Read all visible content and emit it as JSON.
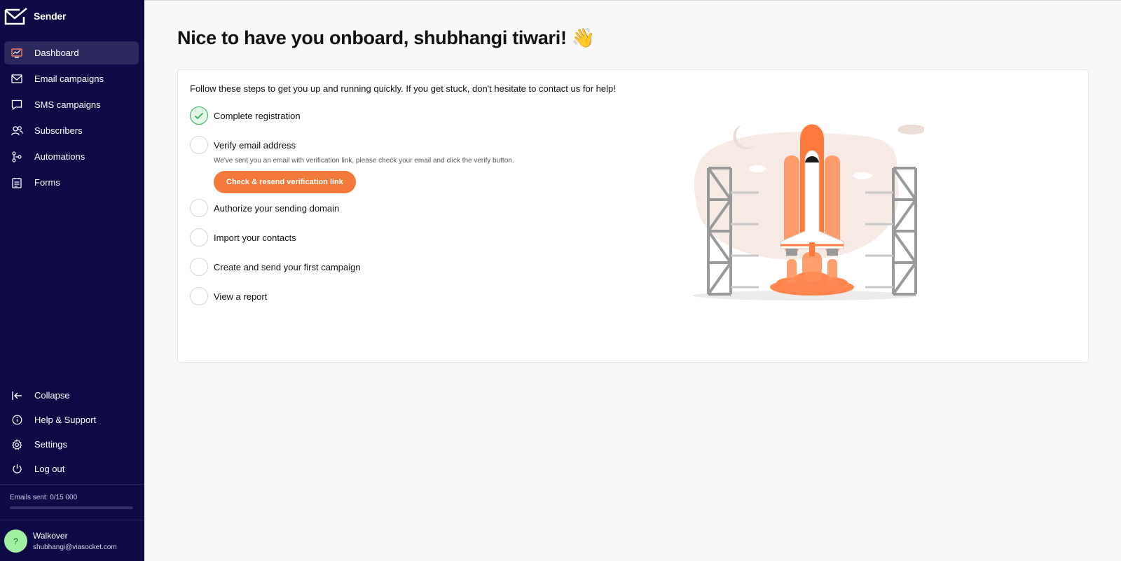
{
  "app": {
    "brand_name": "Sender"
  },
  "sidebar": {
    "nav": [
      {
        "label": "Dashboard",
        "icon": "dashboard-icon",
        "active": true
      },
      {
        "label": "Email campaigns",
        "icon": "envelope-icon"
      },
      {
        "label": "SMS campaigns",
        "icon": "chat-bubble-icon"
      },
      {
        "label": "Subscribers",
        "icon": "users-icon"
      },
      {
        "label": "Automations",
        "icon": "workflow-icon"
      },
      {
        "label": "Forms",
        "icon": "form-icon"
      }
    ],
    "bottom": [
      {
        "label": "Collapse",
        "icon": "collapse-left-icon"
      },
      {
        "label": "Help & Support",
        "icon": "info-icon"
      },
      {
        "label": "Settings",
        "icon": "gear-icon"
      },
      {
        "label": "Log out",
        "icon": "power-icon"
      }
    ],
    "emails_sent_label": "Emails sent: 0/15 000",
    "emails_sent_fraction": 0,
    "user": {
      "initial": "?",
      "name": "Walkover",
      "email": "shubhangi@viasocket.com"
    }
  },
  "main": {
    "headline": "Nice to have you onboard, shubhangi tiwari! 👋",
    "intro": "Follow these steps to get you up and running quickly. If you get stuck, don't hesitate to contact us for help!",
    "steps": [
      {
        "label": "Complete registration",
        "done": true
      },
      {
        "label": "Verify email address",
        "done": false,
        "hint": "We've sent you an email with verification link, please check your email and click the verify button.",
        "button": "Check & resend verification link"
      },
      {
        "label": "Authorize your sending domain",
        "done": false
      },
      {
        "label": "Import your contacts",
        "done": false
      },
      {
        "label": "Create and send your first campaign",
        "done": false
      },
      {
        "label": "View a report",
        "done": false
      }
    ]
  },
  "colors": {
    "sidebar_bg": "#0d0a45",
    "accent_orange": "#f47a3b",
    "success_green": "#35b05a"
  }
}
